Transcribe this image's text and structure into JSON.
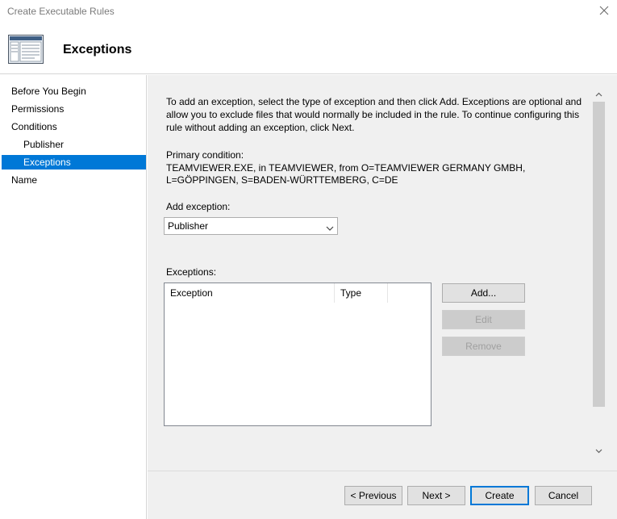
{
  "window": {
    "title": "Create Executable Rules"
  },
  "header": {
    "title": "Exceptions"
  },
  "sidebar": {
    "items": [
      {
        "label": "Before You Begin"
      },
      {
        "label": "Permissions"
      },
      {
        "label": "Conditions"
      },
      {
        "label": "Publisher"
      },
      {
        "label": "Exceptions"
      },
      {
        "label": "Name"
      }
    ]
  },
  "main": {
    "intro": "To add an exception, select the type of exception and then click Add. Exceptions are optional and allow you to exclude files that would normally be included in the rule. To continue configuring this rule without adding an exception, click Next.",
    "primary_condition_label": "Primary condition:",
    "primary_condition_value": "TEAMVIEWER.EXE, in TEAMVIEWER, from O=TEAMVIEWER GERMANY GMBH, L=GÖPPINGEN, S=BADEN-WÜRTTEMBERG, C=DE",
    "add_exception_label": "Add exception:",
    "add_exception_selected": "Publisher",
    "exceptions_label": "Exceptions:",
    "columns": [
      "Exception",
      "Type"
    ],
    "buttons": {
      "add": "Add...",
      "edit": "Edit",
      "remove": "Remove"
    }
  },
  "footer": {
    "previous": "< Previous",
    "next": "Next >",
    "create": "Create",
    "cancel": "Cancel"
  },
  "colors": {
    "accent": "#0078d7",
    "panel": "#f0f0f0"
  },
  "icons": [
    "close-icon",
    "wizard-icon",
    "chevron-down-icon",
    "scroll-up-icon",
    "scroll-down-icon"
  ]
}
